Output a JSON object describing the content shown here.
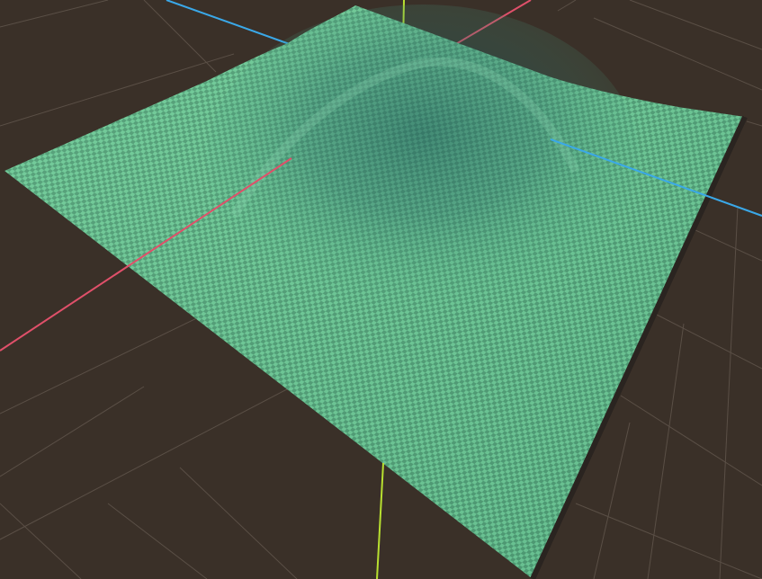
{
  "viewport": {
    "background_color": "#3a3028",
    "grid_color": "#5a4f46",
    "axis_colors": {
      "x": "#e0506a",
      "y": "#b8e030",
      "z": "#3aa8e8"
    },
    "terrain": {
      "base_color": "#5fbf8f",
      "checker_dark": "#4f9c74",
      "checker_light": "#6fcc98",
      "shadow_color": "#2f6e6a",
      "material": "checker-texture",
      "shape": "hill"
    }
  }
}
